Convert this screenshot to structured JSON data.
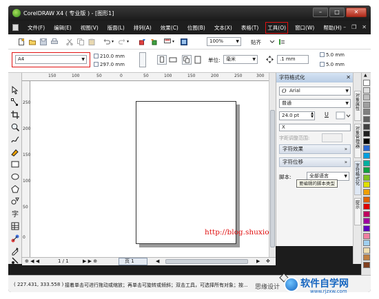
{
  "window": {
    "title": "CorelDRAW X4 ( 专业版 ) - [图形1]",
    "controls": [
      "–",
      "□",
      "✕"
    ],
    "doc_controls": [
      "–",
      "❐",
      "✕"
    ]
  },
  "menu": {
    "items": [
      "文件(F)",
      "编辑(E)",
      "视图(V)",
      "版面(L)",
      "排列(A)",
      "效果(C)",
      "位图(B)",
      "文本(X)",
      "表格(T)",
      "工具(O)",
      "窗口(W)",
      "帮助(H)"
    ],
    "highlighted_index": 9
  },
  "toolbar": {
    "zoom": "100%",
    "snap_label": "贴齐"
  },
  "property_bar": {
    "paper_size": "A4",
    "width": "210.0 mm",
    "height": "297.0 mm",
    "unit_label": "单位:",
    "unit_value": "毫米",
    "nudge": ".1 mm",
    "dup_x": "5.0 mm",
    "dup_y": "5.0 mm"
  },
  "ruler": {
    "h_labels": [
      "150",
      "100",
      "50",
      "0",
      "50",
      "100",
      "150",
      "200",
      "250",
      "300"
    ],
    "v_labels": [
      "250",
      "200",
      "150",
      "100",
      "50",
      "0"
    ]
  },
  "canvas": {
    "watermark": "http://blog.shuxiong.net"
  },
  "page_nav": {
    "page_count": "1 / 1",
    "page_tab": "页 1"
  },
  "status": {
    "coords": "( 227.431, 333.558 )",
    "hint": "接着单击可进行拖动或缩放；再单击可旋转或倾斜；双击工具，可选择所有对象；按..."
  },
  "docker": {
    "title": "字符格式化",
    "font": "Arial",
    "style": "普通",
    "size": "24.0 pt",
    "x_value": "X",
    "kerning_label": "字距调整范围:",
    "section_effects": "字符效果",
    "section_offset": "字符位移",
    "script_label": "脚本:",
    "script_value": "全部语言",
    "tooltip": "要编辑的脚本类型"
  },
  "side_tabs": [
    "对象属性",
    "对象管理器",
    "字符格式化",
    "提示"
  ],
  "palette": {
    "colors": [
      "#ffffff",
      "#e0e0e0",
      "#c0c0c0",
      "#a0a0a0",
      "#808080",
      "#606060",
      "#404040",
      "#202020",
      "#000000",
      "#2a6ad4",
      "#00a0e0",
      "#00b0a0",
      "#10a040",
      "#80c020",
      "#e0e000",
      "#f0a000",
      "#e06000",
      "#e00000",
      "#c00060",
      "#a000a0",
      "#6000c0",
      "#f080a0",
      "#a0d0f0",
      "#f0e0b0",
      "#c08040",
      "#804020"
    ]
  },
  "footer": {
    "text": "思缘设计",
    "brand": "软件自学网",
    "url": "www.rjzxw.com"
  }
}
